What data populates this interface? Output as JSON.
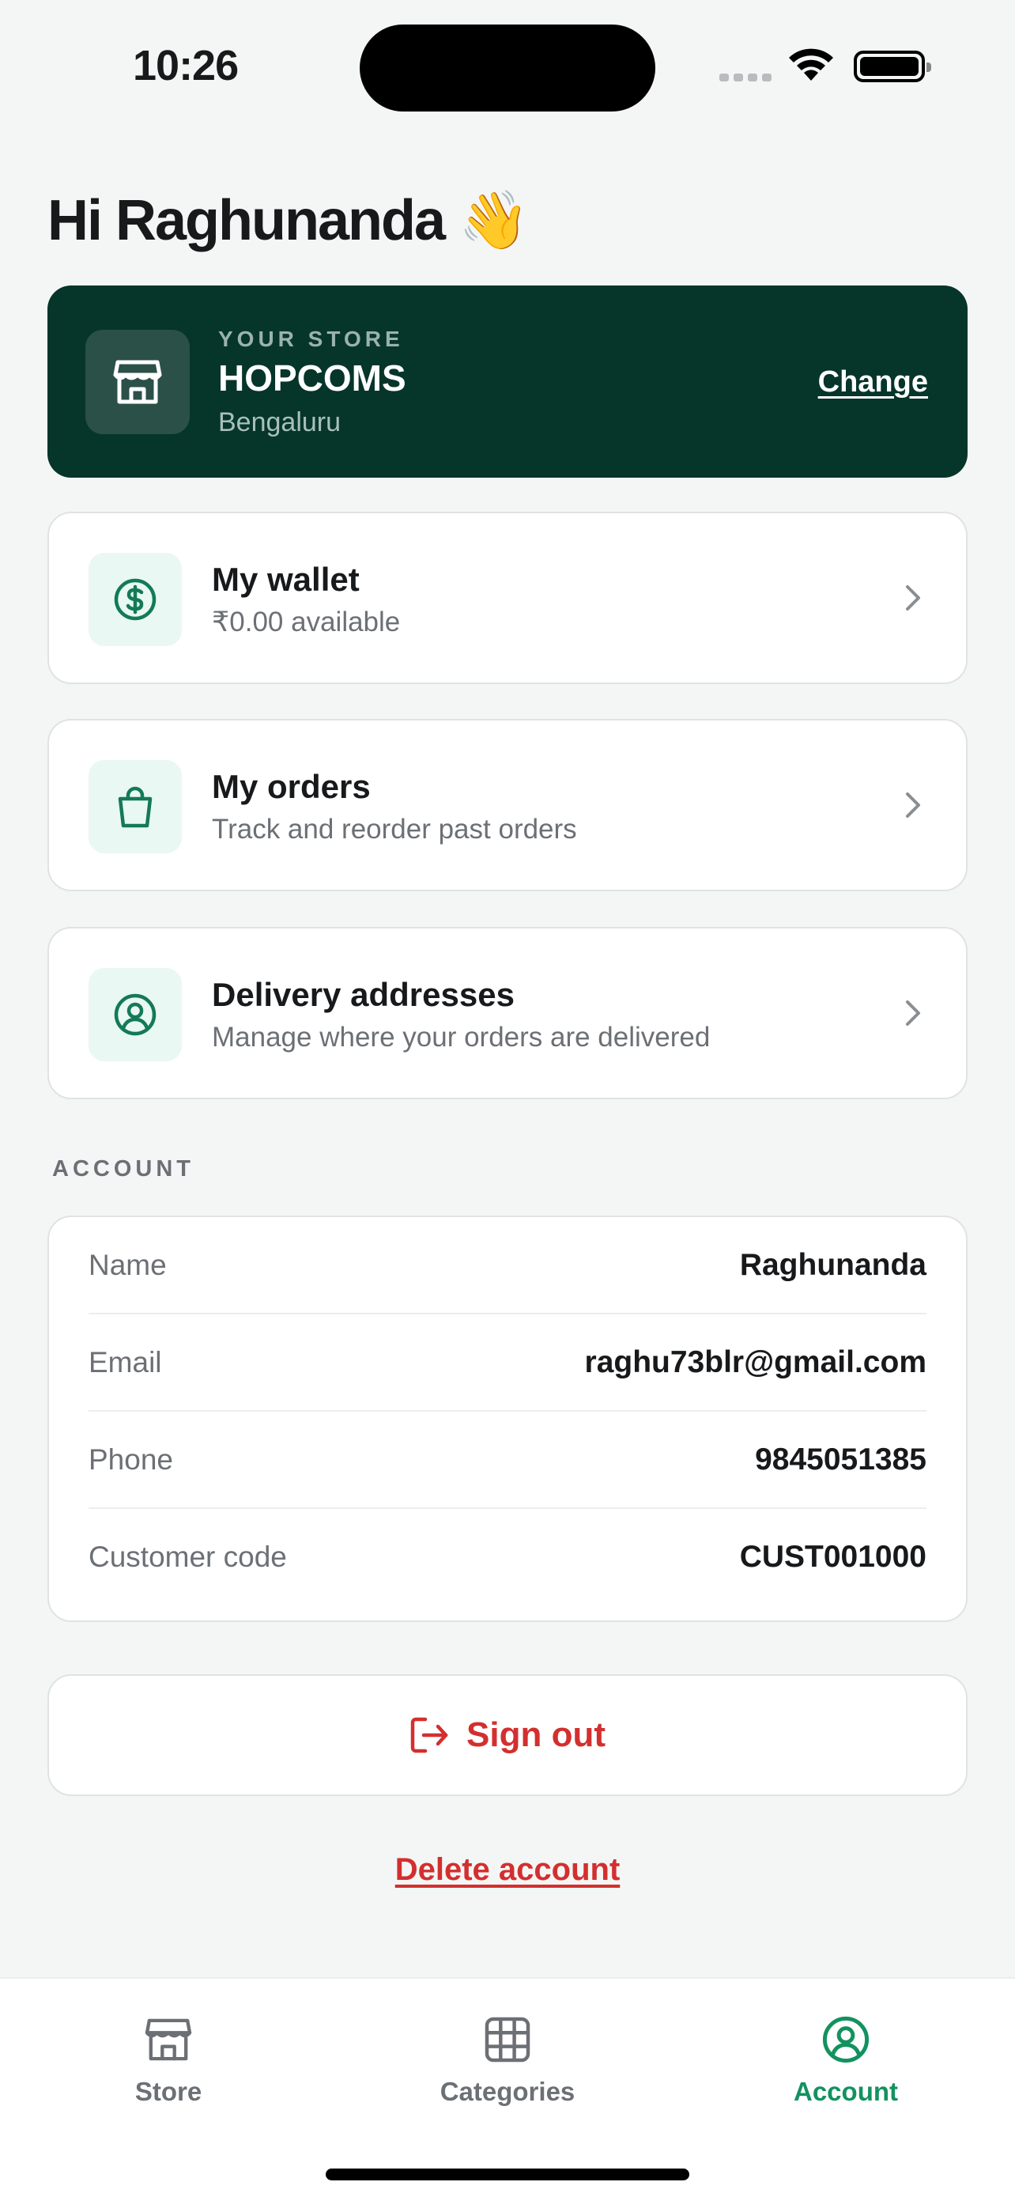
{
  "status_bar": {
    "time": "10:26"
  },
  "greeting": "Hi Raghunanda 👋",
  "store": {
    "kicker": "YOUR STORE",
    "name": "HOPCOMS",
    "city": "Bengaluru",
    "change_label": "Change",
    "icon": "store-icon"
  },
  "menu": [
    {
      "title": "My wallet",
      "subtitle": "₹0.00 available",
      "icon": "dollar-circle-icon"
    },
    {
      "title": "My orders",
      "subtitle": "Track and reorder past orders",
      "icon": "shopping-bag-icon"
    },
    {
      "title": "Delivery addresses",
      "subtitle": "Manage where your orders are delivered",
      "icon": "user-circle-icon"
    }
  ],
  "account": {
    "section_label": "ACCOUNT",
    "rows": [
      {
        "label": "Name",
        "value": "Raghunanda"
      },
      {
        "label": "Email",
        "value": "raghu73blr@gmail.com"
      },
      {
        "label": "Phone",
        "value": "9845051385"
      },
      {
        "label": "Customer code",
        "value": "CUST001000"
      }
    ]
  },
  "sign_out_label": "Sign out",
  "delete_account_label": "Delete account",
  "tabs": [
    {
      "label": "Store",
      "icon": "store-icon",
      "active": false
    },
    {
      "label": "Categories",
      "icon": "grid-icon",
      "active": false
    },
    {
      "label": "Account",
      "icon": "user-circle-icon",
      "active": true
    }
  ],
  "colors": {
    "brand_dark": "#06352a",
    "accent_green": "#13925f",
    "danger_red": "#d32f2f"
  }
}
